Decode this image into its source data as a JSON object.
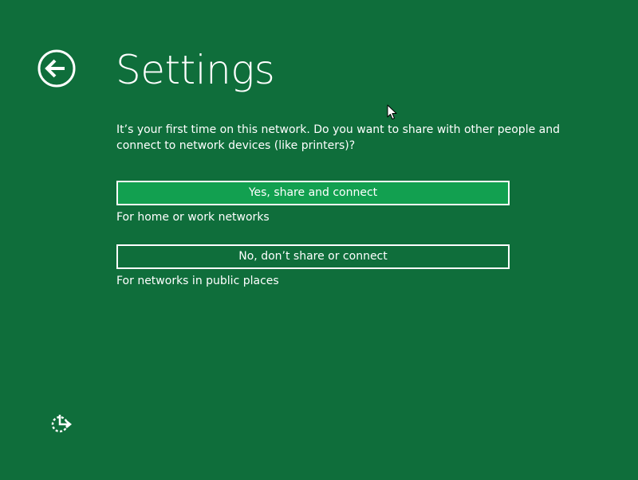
{
  "header": {
    "title": "Settings",
    "back_icon": "back-arrow-icon"
  },
  "main": {
    "prompt": "It’s your first time on this network. Do you want to share with other people and connect to network devices (like printers)?",
    "options": [
      {
        "label": "Yes, share and connect",
        "description": "For home or work networks"
      },
      {
        "label": "No, don’t share or connect",
        "description": "For networks in public places"
      }
    ]
  },
  "footer": {
    "ease_of_access_icon": "ease-of-access-icon"
  },
  "colors": {
    "background": "#0f6e3b",
    "accent_button": "#12a050",
    "text": "#ffffff"
  }
}
